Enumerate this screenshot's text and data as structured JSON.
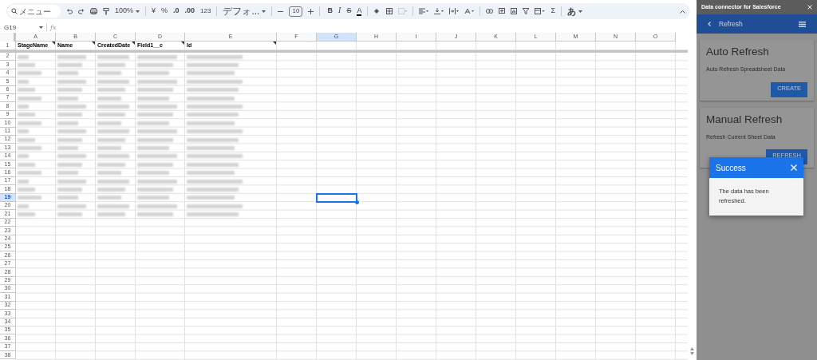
{
  "toolbar": {
    "search": {
      "placeholder": "メニュー"
    },
    "zoom": "100%",
    "currency": "¥",
    "percent": "%",
    "decrease_decimal": ".0",
    "increase_decimal": ".00",
    "number_format": "123",
    "font": "デフォ...",
    "font_size": "10",
    "bold": "B",
    "italic": "I",
    "strikethrough": "S",
    "text_color": "A",
    "sum": "Σ",
    "input_tools": "あ"
  },
  "formula_bar": {
    "name_box": "G19",
    "fx": "fx"
  },
  "sheet": {
    "columns": [
      {
        "label": "A",
        "selected": false
      },
      {
        "label": "B",
        "selected": false
      },
      {
        "label": "C",
        "selected": false
      },
      {
        "label": "D",
        "selected": false
      },
      {
        "label": "E",
        "selected": false
      },
      {
        "label": "F",
        "selected": false
      },
      {
        "label": "G",
        "selected": true
      },
      {
        "label": "H",
        "selected": false
      },
      {
        "label": "I",
        "selected": false
      },
      {
        "label": "J",
        "selected": false
      },
      {
        "label": "K",
        "selected": false
      },
      {
        "label": "L",
        "selected": false
      },
      {
        "label": "M",
        "selected": false
      },
      {
        "label": "N",
        "selected": false
      },
      {
        "label": "O",
        "selected": false
      }
    ],
    "header_row": {
      "number": "1",
      "cells": [
        "StageName",
        "Name",
        "CreatedDate",
        "Field1__c",
        "Id"
      ]
    },
    "rows": [
      {
        "number": "2",
        "blurred": true,
        "selected": false
      },
      {
        "number": "3",
        "blurred": true,
        "selected": false
      },
      {
        "number": "4",
        "blurred": true,
        "selected": false
      },
      {
        "number": "5",
        "blurred": true,
        "selected": false
      },
      {
        "number": "6",
        "blurred": true,
        "selected": false
      },
      {
        "number": "7",
        "blurred": true,
        "selected": false
      },
      {
        "number": "8",
        "blurred": true,
        "selected": false
      },
      {
        "number": "9",
        "blurred": true,
        "selected": false
      },
      {
        "number": "10",
        "blurred": true,
        "selected": false
      },
      {
        "number": "11",
        "blurred": true,
        "selected": false
      },
      {
        "number": "12",
        "blurred": true,
        "selected": false
      },
      {
        "number": "13",
        "blurred": true,
        "selected": false
      },
      {
        "number": "14",
        "blurred": true,
        "selected": false
      },
      {
        "number": "15",
        "blurred": true,
        "selected": false
      },
      {
        "number": "16",
        "blurred": true,
        "selected": false
      },
      {
        "number": "17",
        "blurred": true,
        "selected": false
      },
      {
        "number": "18",
        "blurred": true,
        "selected": false
      },
      {
        "number": "19",
        "blurred": true,
        "selected": true
      },
      {
        "number": "20",
        "blurred": true,
        "selected": false
      },
      {
        "number": "21",
        "blurred": true,
        "selected": false
      },
      {
        "number": "22",
        "blurred": false,
        "selected": false
      },
      {
        "number": "23",
        "blurred": false,
        "selected": false
      },
      {
        "number": "24",
        "blurred": false,
        "selected": false
      },
      {
        "number": "25",
        "blurred": false,
        "selected": false
      },
      {
        "number": "26",
        "blurred": false,
        "selected": false
      },
      {
        "number": "27",
        "blurred": false,
        "selected": false
      },
      {
        "number": "28",
        "blurred": false,
        "selected": false
      },
      {
        "number": "29",
        "blurred": false,
        "selected": false
      },
      {
        "number": "30",
        "blurred": false,
        "selected": false
      },
      {
        "number": "31",
        "blurred": false,
        "selected": false
      },
      {
        "number": "32",
        "blurred": false,
        "selected": false
      },
      {
        "number": "33",
        "blurred": false,
        "selected": false
      },
      {
        "number": "34",
        "blurred": false,
        "selected": false
      },
      {
        "number": "35",
        "blurred": false,
        "selected": false
      },
      {
        "number": "36",
        "blurred": false,
        "selected": false
      },
      {
        "number": "37",
        "blurred": false,
        "selected": false
      },
      {
        "number": "38",
        "blurred": false,
        "selected": false
      }
    ]
  },
  "side_panel": {
    "title": "Data connector for Salesforce",
    "header": "Refresh",
    "cards": [
      {
        "title": "Auto Refresh",
        "description": "Auto Refresh Spreadsheet Data",
        "button": "CREATE"
      },
      {
        "title": "Manual Refresh",
        "description": "Refresh Current Sheet Data",
        "button": "REFRESH"
      }
    ],
    "dialog": {
      "title": "Success",
      "message": "The data has been refreshed."
    }
  }
}
